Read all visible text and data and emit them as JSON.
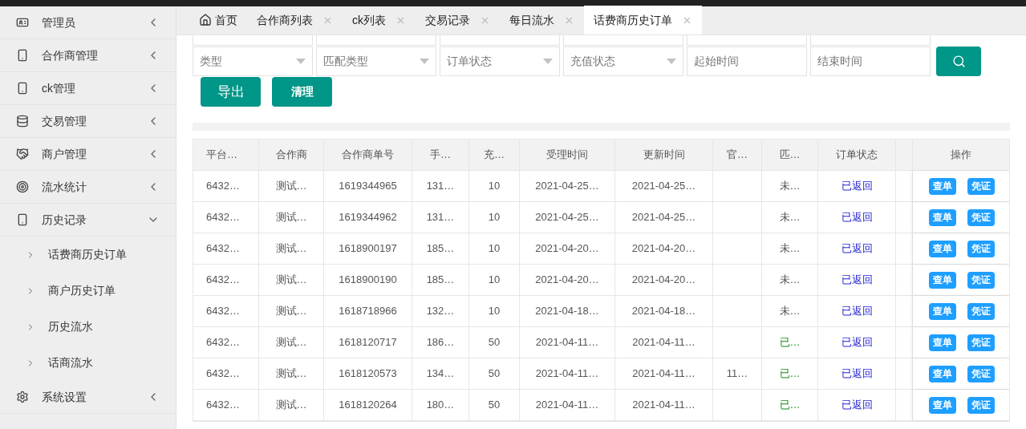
{
  "sidebar": {
    "items": [
      {
        "label": "管理员",
        "expanded": false
      },
      {
        "label": "合作商管理",
        "expanded": false
      },
      {
        "label": "ck管理",
        "expanded": false
      },
      {
        "label": "交易管理",
        "expanded": false
      },
      {
        "label": "商户管理",
        "expanded": false
      },
      {
        "label": "流水统计",
        "expanded": false
      },
      {
        "label": "历史记录",
        "expanded": true,
        "children": [
          {
            "label": "话费商历史订单"
          },
          {
            "label": "商户历史订单"
          },
          {
            "label": "历史流水"
          },
          {
            "label": "话商流水"
          }
        ]
      },
      {
        "label": "系统设置",
        "expanded": false
      }
    ]
  },
  "tabs": [
    {
      "label": "首页",
      "kind": "home",
      "selected": false
    },
    {
      "label": "合作商列表",
      "kind": "closable",
      "selected": false
    },
    {
      "label": "ck列表",
      "kind": "closable",
      "selected": false
    },
    {
      "label": "交易记录",
      "kind": "closable",
      "selected": false
    },
    {
      "label": "每日流水",
      "kind": "closable",
      "selected": false
    },
    {
      "label": "话费商历史订单",
      "kind": "closable",
      "selected": true
    }
  ],
  "filters": [
    {
      "placeholder": "类型",
      "kind": "select"
    },
    {
      "placeholder": "匹配类型",
      "kind": "select"
    },
    {
      "placeholder": "订单状态",
      "kind": "select"
    },
    {
      "placeholder": "充值状态",
      "kind": "select"
    },
    {
      "placeholder": "起始时间",
      "kind": "input"
    },
    {
      "placeholder": "结束时间",
      "kind": "input"
    }
  ],
  "buttons": [
    "导出",
    "清理"
  ],
  "table": {
    "columns": [
      "平台…",
      "合作商",
      "合作商单号",
      "手…",
      "充…",
      "受理时间",
      "更新时间",
      "官…",
      "匹…",
      "订单状态",
      "",
      "操作"
    ],
    "rows": [
      {
        "cells": [
          "6432…",
          "测试…",
          "1619344965",
          "131…",
          "10",
          "2021-04-25…",
          "2021-04-25…",
          "",
          "未…",
          "已返回"
        ],
        "matched": false,
        "actions": [
          "查单",
          "凭证"
        ]
      },
      {
        "cells": [
          "6432…",
          "测试…",
          "1619344962",
          "131…",
          "10",
          "2021-04-25…",
          "2021-04-25…",
          "",
          "未…",
          "已返回"
        ],
        "matched": false,
        "actions": [
          "查单",
          "凭证"
        ]
      },
      {
        "cells": [
          "6432…",
          "测试…",
          "1618900197",
          "185…",
          "10",
          "2021-04-20…",
          "2021-04-20…",
          "",
          "未…",
          "已返回"
        ],
        "matched": false,
        "actions": [
          "查单",
          "凭证"
        ]
      },
      {
        "cells": [
          "6432…",
          "测试…",
          "1618900190",
          "185…",
          "10",
          "2021-04-20…",
          "2021-04-20…",
          "",
          "未…",
          "已返回"
        ],
        "matched": false,
        "actions": [
          "查单",
          "凭证"
        ]
      },
      {
        "cells": [
          "6432…",
          "测试…",
          "1618718966",
          "132…",
          "10",
          "2021-04-18…",
          "2021-04-18…",
          "",
          "未…",
          "已返回"
        ],
        "matched": false,
        "actions": [
          "查单",
          "凭证"
        ]
      },
      {
        "cells": [
          "6432…",
          "测试…",
          "1618120717",
          "186…",
          "50",
          "2021-04-11…",
          "2021-04-11…",
          "",
          "已…",
          "已返回"
        ],
        "matched": true,
        "actions": [
          "查单",
          "凭证"
        ]
      },
      {
        "cells": [
          "6432…",
          "测试…",
          "1618120573",
          "134…",
          "50",
          "2021-04-11…",
          "2021-04-11…",
          "11…",
          "已…",
          "已返回"
        ],
        "matched": true,
        "actions": [
          "查单",
          "凭证"
        ]
      },
      {
        "cells": [
          "6432…",
          "测试…",
          "1618120264",
          "180…",
          "50",
          "2021-04-11…",
          "2021-04-11…",
          "",
          "已…",
          "已返回"
        ],
        "matched": true,
        "actions": [
          "查单",
          "凭证"
        ]
      }
    ]
  }
}
